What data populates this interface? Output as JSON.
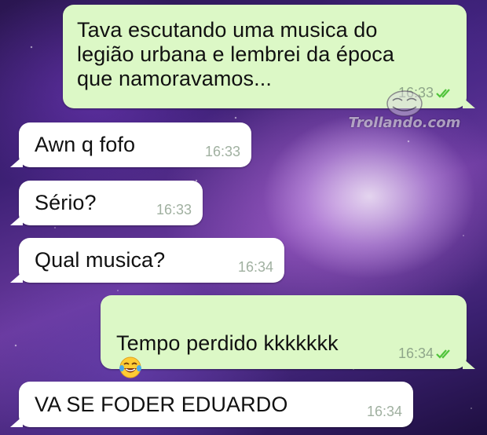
{
  "messages": [
    {
      "direction": "out",
      "text": "Tava escutando uma musica do\nlegião urbana e lembrei da época\nque namoravamos...",
      "time": "16:33",
      "status": "read"
    },
    {
      "direction": "in",
      "text": "Awn q fofo",
      "time": "16:33"
    },
    {
      "direction": "in",
      "text": "Sério?",
      "time": "16:33"
    },
    {
      "direction": "in",
      "text": "Qual musica?",
      "time": "16:34"
    },
    {
      "direction": "out",
      "text": "Tempo perdido kkkkkkk",
      "emojis": [
        "face-with-tears-of-joy-icon",
        "face-with-tears-of-joy-icon"
      ],
      "time": "16:34",
      "status": "read"
    },
    {
      "direction": "in",
      "text": "VA SE FODER EDUARDO",
      "time": "16:34"
    }
  ],
  "watermark": {
    "text": "Trollando.com"
  },
  "colors": {
    "outgoing_bubble": "#dcf8c6",
    "incoming_bubble": "#ffffff",
    "read_ticks": "#4fc33a",
    "timestamp": "#8fa68a"
  }
}
